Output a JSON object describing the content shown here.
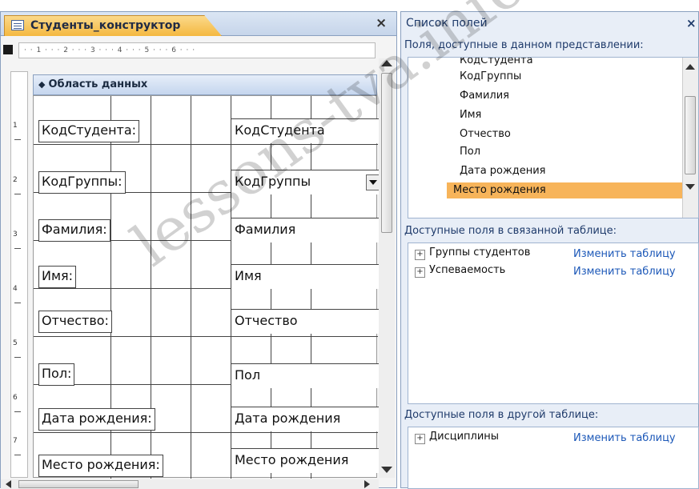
{
  "designer": {
    "tab_title": "Студенты_конструктор",
    "close_glyph": "×",
    "ruler_text": "· · 1 · · · 2 · · · 3 · · · 4 · · · 5 · · · 6 · · ·",
    "vertical_ruler": [
      "1",
      "2",
      "3",
      "4",
      "5",
      "6",
      "7"
    ],
    "section": {
      "label": "Область данных",
      "icon": "section-arrow-icon"
    },
    "controls": [
      {
        "label": "КодСтудента:",
        "field": "КодСтудента"
      },
      {
        "label": "КодГруппы:",
        "field": "КодГруппы",
        "combo": true
      },
      {
        "label": "Фамилия:",
        "field": "Фамилия"
      },
      {
        "label": "Имя:",
        "field": "Имя"
      },
      {
        "label": "Отчество:",
        "field": "Отчество"
      },
      {
        "label": "Пол:",
        "field": "Пол"
      },
      {
        "label": "Дата рождения:",
        "field": "Дата рождения"
      },
      {
        "label": "Место рождения:",
        "field": "Место рождения"
      }
    ]
  },
  "field_list": {
    "title": "Список полей",
    "close_glyph": "×",
    "available_header": "Поля, доступные в данном представлении:",
    "fields": [
      "КодСтудента",
      "КодГруппы",
      "Фамилия",
      "Имя",
      "Отчество",
      "Пол",
      "Дата рождения",
      "Место рождения"
    ],
    "selected_field": "Место рождения",
    "related_header": "Доступные поля в связанной таблице:",
    "related_tables": [
      {
        "name": "Группы студентов",
        "action": "Изменить таблицу"
      },
      {
        "name": "Успеваемость",
        "action": "Изменить таблицу"
      }
    ],
    "other_header": "Доступные поля в другой таблице:",
    "other_tables": [
      {
        "name": "Дисциплины",
        "action": "Изменить таблицу"
      }
    ]
  },
  "watermark": "lessons-tva.info",
  "colors": {
    "selected_field": "#f7b45a",
    "link": "#1c58b8",
    "active_tab": "#f4b840"
  }
}
